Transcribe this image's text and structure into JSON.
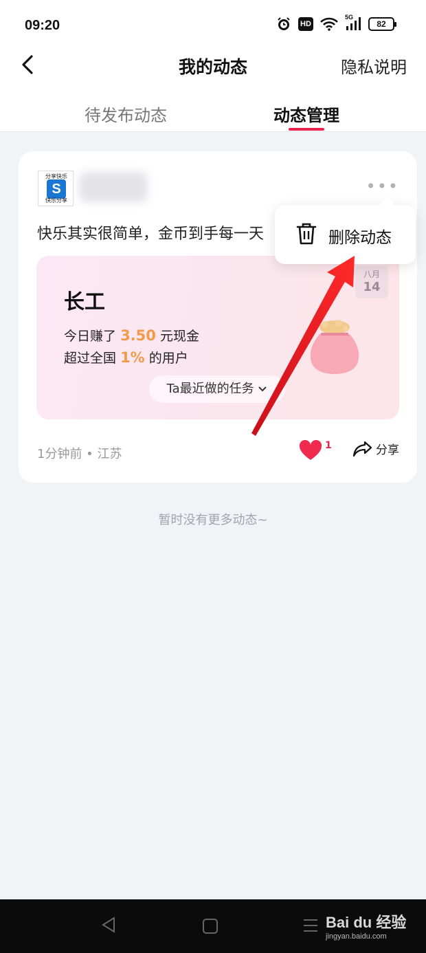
{
  "status_bar": {
    "time": "09:20",
    "hd_label": "HD",
    "network_label": "5G",
    "battery": "82"
  },
  "header": {
    "title": "我的动态",
    "right_link": "隐私说明"
  },
  "tabs": [
    {
      "label": "待发布动态",
      "active": false
    },
    {
      "label": "动态管理",
      "active": true
    }
  ],
  "post": {
    "avatar": {
      "top_text": "分享快乐",
      "logo_letter": "S",
      "bottom_text": "快乐分享"
    },
    "text": "快乐其实很简单，金币到手每一天",
    "card": {
      "title": "长工",
      "line1_prefix": "今日赚了",
      "line1_value": "3.50",
      "line1_suffix": "元现金",
      "line2_prefix": "超过全国",
      "line2_value": "1%",
      "line2_suffix": "的用户",
      "tasks_button": "Ta最近做的任务",
      "date_month": "八月",
      "date_day": "14"
    },
    "meta": "1分钟前 • 江苏",
    "likes": "1",
    "share_label": "分享"
  },
  "popup_menu": {
    "delete_label": "删除动态"
  },
  "footer_text": "暂时没有更多动态~",
  "watermark": {
    "main": "Bai du 经验",
    "sub": "jingyan.baidu.com"
  },
  "colors": {
    "accent": "#e9244c",
    "highlight": "#f39a4a",
    "background": "#f2f3f7"
  }
}
